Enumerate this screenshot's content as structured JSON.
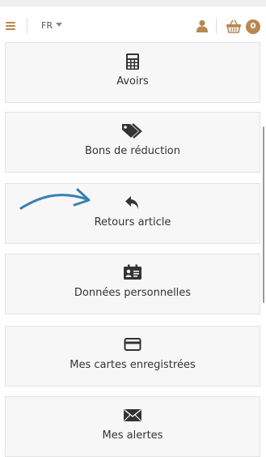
{
  "header": {
    "language": "FR",
    "cart_count": "0",
    "icons": [
      "menu-icon",
      "user-icon",
      "basket-icon"
    ]
  },
  "tiles": [
    {
      "label": "Avoirs",
      "icon": "calculator-icon"
    },
    {
      "label": "Bons de réduction",
      "icon": "tags-icon"
    },
    {
      "label": "Retours article",
      "icon": "reply-icon"
    },
    {
      "label": "Données personnelles",
      "icon": "id-card-icon"
    },
    {
      "label": "Mes cartes enregistrées",
      "icon": "credit-card-icon"
    },
    {
      "label": "Mes alertes",
      "icon": "envelope-icon"
    }
  ],
  "colors": {
    "accent": "#b5894f",
    "annotation_arrow": "#3b7fb0"
  }
}
